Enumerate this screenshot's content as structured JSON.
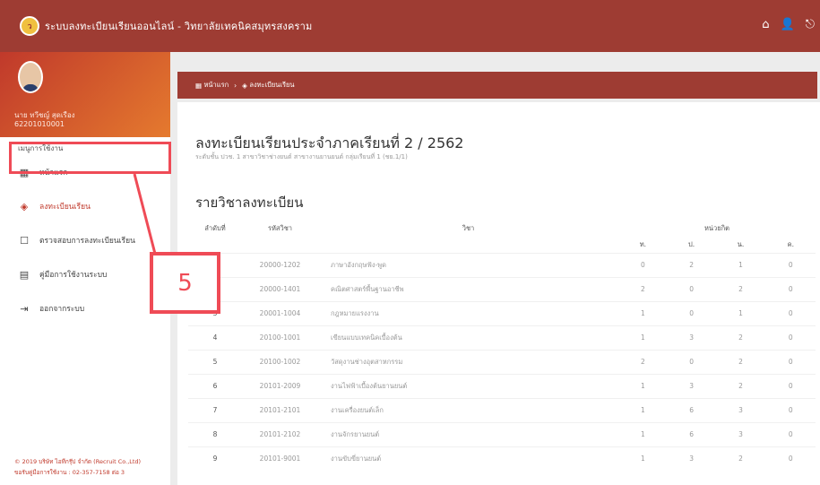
{
  "app": {
    "title": "ระบบลงทะเบียนเรียนออนไลน์ - วิทยาลัยเทคนิคสมุทรสงคราม",
    "logo_text": "ว"
  },
  "top_icons": {
    "home": "⌂",
    "user": "👤",
    "logout": "⎋"
  },
  "profile": {
    "name": "นาย ทวีชญ์ สุดเรือง",
    "id": "62201010001"
  },
  "menu": {
    "caption": "เมนูการใช้งาน",
    "items": [
      {
        "label": "หน้าแรก",
        "icon": "▦"
      },
      {
        "label": "ลงทะเบียนเรียน",
        "icon": "◈"
      },
      {
        "label": "ตรวจสอบการลงทะเบียนเรียน",
        "icon": "☐"
      },
      {
        "label": "คู่มือการใช้งานระบบ",
        "icon": "▤"
      },
      {
        "label": "ออกจากระบบ",
        "icon": "⇥"
      }
    ]
  },
  "annotation": {
    "step": "5",
    "color": "#ef4b56"
  },
  "footer": {
    "line1": "© 2019 บริษัท ไอทีกรุ๊ป จำกัด (Recruit Co.,Ltd)",
    "line2": "ขอรับคู่มือการใช้งาน : 02-357-7158 ต่อ 3"
  },
  "breadcrumb": {
    "home": "หน้าแรก",
    "current": "ลงทะเบียนเรียน",
    "home_icon": "▦",
    "current_icon": "◈",
    "sep": "›"
  },
  "page": {
    "title": "ลงทะเบียนเรียนประจำภาคเรียนที่ 2 / 2562",
    "subtitle": "ระดับชั้น ปวช. 1 สาขาวิชาช่างยนต์ สาขางานยานยนต์ กลุ่มเรียนที่ 1 (ชย.1/1)",
    "section_title": "รายวิชาลงทะเบียน"
  },
  "table": {
    "headers": {
      "no": "ลำดับที่",
      "code": "รหัสวิชา",
      "name": "วิชา",
      "units": "หน่วยกิต",
      "t": "ท.",
      "p": "ป.",
      "n": "น.",
      "h": "ค."
    },
    "rows": [
      {
        "no": "1",
        "code": "20000-1202",
        "name": "ภาษาอังกฤษฟัง-พูด",
        "t": "0",
        "p": "2",
        "n": "1",
        "h": "0"
      },
      {
        "no": "2",
        "code": "20000-1401",
        "name": "คณิตศาสตร์พื้นฐานอาชีพ",
        "t": "2",
        "p": "0",
        "n": "2",
        "h": "0"
      },
      {
        "no": "3",
        "code": "20001-1004",
        "name": "กฎหมายแรงงาน",
        "t": "1",
        "p": "0",
        "n": "1",
        "h": "0"
      },
      {
        "no": "4",
        "code": "20100-1001",
        "name": "เขียนแบบเทคนิคเบื้องต้น",
        "t": "1",
        "p": "3",
        "n": "2",
        "h": "0"
      },
      {
        "no": "5",
        "code": "20100-1002",
        "name": "วัสดุงานช่างอุตสาหกรรม",
        "t": "2",
        "p": "0",
        "n": "2",
        "h": "0"
      },
      {
        "no": "6",
        "code": "20101-2009",
        "name": "งานไฟฟ้าเบื้องต้นยานยนต์",
        "t": "1",
        "p": "3",
        "n": "2",
        "h": "0"
      },
      {
        "no": "7",
        "code": "20101-2101",
        "name": "งานเครื่องยนต์เล็ก",
        "t": "1",
        "p": "6",
        "n": "3",
        "h": "0"
      },
      {
        "no": "8",
        "code": "20101-2102",
        "name": "งานจักรยานยนต์",
        "t": "1",
        "p": "6",
        "n": "3",
        "h": "0"
      },
      {
        "no": "9",
        "code": "20101-9001",
        "name": "งานขับขี่ยานยนต์",
        "t": "1",
        "p": "3",
        "n": "2",
        "h": "0"
      }
    ]
  }
}
